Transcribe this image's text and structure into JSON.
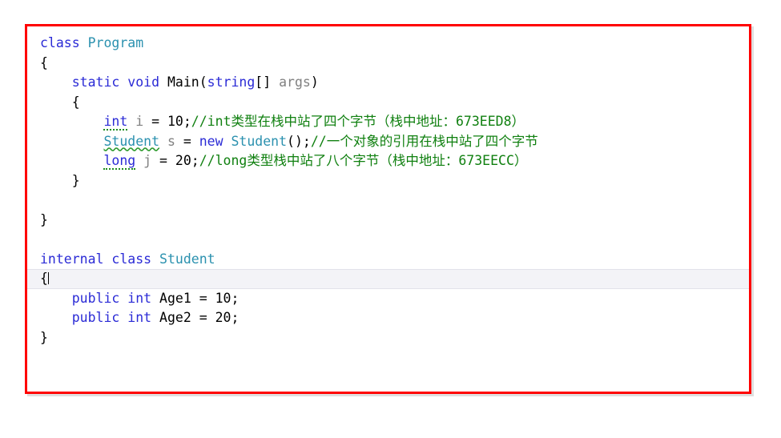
{
  "window": {
    "kind": "code-editor-screenshot",
    "annotation_color": "#ff0000"
  },
  "editor": {
    "language": "C#",
    "colors": {
      "keyword": "#2b2bd6",
      "type": "#2b91af",
      "identifier": "#808080",
      "comment": "#108010",
      "plain": "#000000",
      "current_line_background": "#f3f3f7",
      "annotation_border": "#ff0000"
    },
    "lines": [
      {
        "n": 1,
        "current": false,
        "tokens": [
          {
            "t": "class",
            "c": "kw"
          },
          {
            "t": " ",
            "c": "plain"
          },
          {
            "t": "Program",
            "c": "type"
          }
        ]
      },
      {
        "n": 2,
        "current": false,
        "tokens": [
          {
            "t": "{",
            "c": "plain"
          }
        ]
      },
      {
        "n": 3,
        "current": false,
        "tokens": [
          {
            "t": "    ",
            "c": "plain"
          },
          {
            "t": "static",
            "c": "kw"
          },
          {
            "t": " ",
            "c": "plain"
          },
          {
            "t": "void",
            "c": "kw"
          },
          {
            "t": " ",
            "c": "plain"
          },
          {
            "t": "Main",
            "c": "plain"
          },
          {
            "t": "(",
            "c": "plain"
          },
          {
            "t": "string",
            "c": "kw"
          },
          {
            "t": "[]",
            "c": "plain"
          },
          {
            "t": " ",
            "c": "plain"
          },
          {
            "t": "args",
            "c": "ident"
          },
          {
            "t": ")",
            "c": "plain"
          }
        ]
      },
      {
        "n": 4,
        "current": false,
        "tokens": [
          {
            "t": "    ",
            "c": "plain"
          },
          {
            "t": "{",
            "c": "plain"
          }
        ]
      },
      {
        "n": 5,
        "current": false,
        "tokens": [
          {
            "t": "        ",
            "c": "plain"
          },
          {
            "t": "int",
            "c": "kw hint"
          },
          {
            "t": " ",
            "c": "plain"
          },
          {
            "t": "i",
            "c": "ident"
          },
          {
            "t": " = ",
            "c": "plain"
          },
          {
            "t": "10",
            "c": "plain"
          },
          {
            "t": ";",
            "c": "plain"
          },
          {
            "t": "//int类型在栈中站了四个字节（栈中地址：673EED8）",
            "c": "comment"
          }
        ]
      },
      {
        "n": 6,
        "current": false,
        "tokens": [
          {
            "t": "        ",
            "c": "plain"
          },
          {
            "t": "Student",
            "c": "type squiggle"
          },
          {
            "t": " ",
            "c": "plain"
          },
          {
            "t": "s",
            "c": "ident"
          },
          {
            "t": " = ",
            "c": "plain"
          },
          {
            "t": "new",
            "c": "kw"
          },
          {
            "t": " ",
            "c": "plain"
          },
          {
            "t": "Student",
            "c": "type"
          },
          {
            "t": "();",
            "c": "plain"
          },
          {
            "t": "//一个对象的引用在栈中站了四个字节",
            "c": "comment"
          }
        ]
      },
      {
        "n": 7,
        "current": false,
        "tokens": [
          {
            "t": "        ",
            "c": "plain"
          },
          {
            "t": "long",
            "c": "kw hint"
          },
          {
            "t": " ",
            "c": "plain"
          },
          {
            "t": "j",
            "c": "ident"
          },
          {
            "t": " = ",
            "c": "plain"
          },
          {
            "t": "20",
            "c": "plain"
          },
          {
            "t": ";",
            "c": "plain"
          },
          {
            "t": "//long类型栈中站了八个字节（栈中地址：673EECC）",
            "c": "comment"
          }
        ]
      },
      {
        "n": 8,
        "current": false,
        "tokens": [
          {
            "t": "    ",
            "c": "plain"
          },
          {
            "t": "}",
            "c": "plain"
          }
        ]
      },
      {
        "n": 9,
        "current": false,
        "tokens": [
          {
            "t": "",
            "c": "plain"
          }
        ]
      },
      {
        "n": 10,
        "current": false,
        "tokens": [
          {
            "t": "}",
            "c": "plain"
          }
        ]
      },
      {
        "n": 11,
        "current": false,
        "tokens": [
          {
            "t": "",
            "c": "plain"
          }
        ]
      },
      {
        "n": 12,
        "current": false,
        "tokens": [
          {
            "t": "internal",
            "c": "kw"
          },
          {
            "t": " ",
            "c": "plain"
          },
          {
            "t": "class",
            "c": "kw"
          },
          {
            "t": " ",
            "c": "plain"
          },
          {
            "t": "Student",
            "c": "type"
          }
        ]
      },
      {
        "n": 13,
        "current": true,
        "caret_after": true,
        "tokens": [
          {
            "t": "{",
            "c": "plain"
          }
        ]
      },
      {
        "n": 14,
        "current": false,
        "tokens": [
          {
            "t": "    ",
            "c": "plain"
          },
          {
            "t": "public",
            "c": "kw"
          },
          {
            "t": " ",
            "c": "plain"
          },
          {
            "t": "int",
            "c": "kw"
          },
          {
            "t": " ",
            "c": "plain"
          },
          {
            "t": "Age1",
            "c": "plain"
          },
          {
            "t": " = ",
            "c": "plain"
          },
          {
            "t": "10",
            "c": "plain"
          },
          {
            "t": ";",
            "c": "plain"
          }
        ]
      },
      {
        "n": 15,
        "current": false,
        "tokens": [
          {
            "t": "    ",
            "c": "plain"
          },
          {
            "t": "public",
            "c": "kw"
          },
          {
            "t": " ",
            "c": "plain"
          },
          {
            "t": "int",
            "c": "kw"
          },
          {
            "t": " ",
            "c": "plain"
          },
          {
            "t": "Age2",
            "c": "plain"
          },
          {
            "t": " = ",
            "c": "plain"
          },
          {
            "t": "20",
            "c": "plain"
          },
          {
            "t": ";",
            "c": "plain"
          }
        ]
      },
      {
        "n": 16,
        "current": false,
        "tokens": [
          {
            "t": "}",
            "c": "plain"
          }
        ]
      }
    ]
  }
}
